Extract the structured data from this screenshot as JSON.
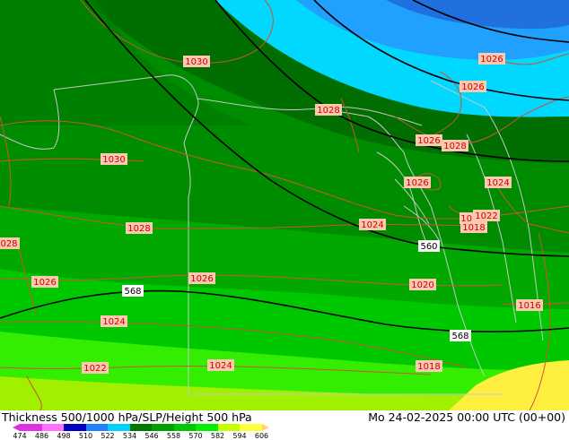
{
  "title": "Thickness 500/1000 hPa/SLP/Height 500 hPa",
  "datetime": "Mo 24-02-2025 00:00 UTC (00+00)",
  "colors": {
    "isobar": "#cc5533",
    "height_contour": "#000000",
    "border": "#c8c8c8"
  },
  "scale": {
    "ticks": [
      "474",
      "486",
      "498",
      "510",
      "522",
      "534",
      "546",
      "558",
      "570",
      "582",
      "594",
      "606"
    ],
    "colors": [
      "#e030e0",
      "#ff70ff",
      "#0000c0",
      "#2080ff",
      "#00d0ff",
      "#007800",
      "#00a000",
      "#00c800",
      "#00f000",
      "#c8ff00",
      "#ffff40",
      "#ffd080"
    ]
  },
  "slp_labels": [
    {
      "text": "1030"
    },
    {
      "text": "1028"
    },
    {
      "text": "1026"
    },
    {
      "text": "1026"
    },
    {
      "text": "1026"
    },
    {
      "text": "1028"
    },
    {
      "text": "1026"
    },
    {
      "text": "1030"
    },
    {
      "text": "1024"
    },
    {
      "text": "1028"
    },
    {
      "text": "1024"
    },
    {
      "text": "1018"
    },
    {
      "text": "1022"
    },
    {
      "text": "1018"
    },
    {
      "text": "028"
    },
    {
      "text": "1026"
    },
    {
      "text": "1026"
    },
    {
      "text": "1020"
    },
    {
      "text": "1016"
    },
    {
      "text": "1024"
    },
    {
      "text": "1022"
    },
    {
      "text": "1024"
    },
    {
      "text": "1018"
    }
  ],
  "height_labels": [
    {
      "text": "560"
    },
    {
      "text": "568"
    },
    {
      "text": "568"
    }
  ]
}
